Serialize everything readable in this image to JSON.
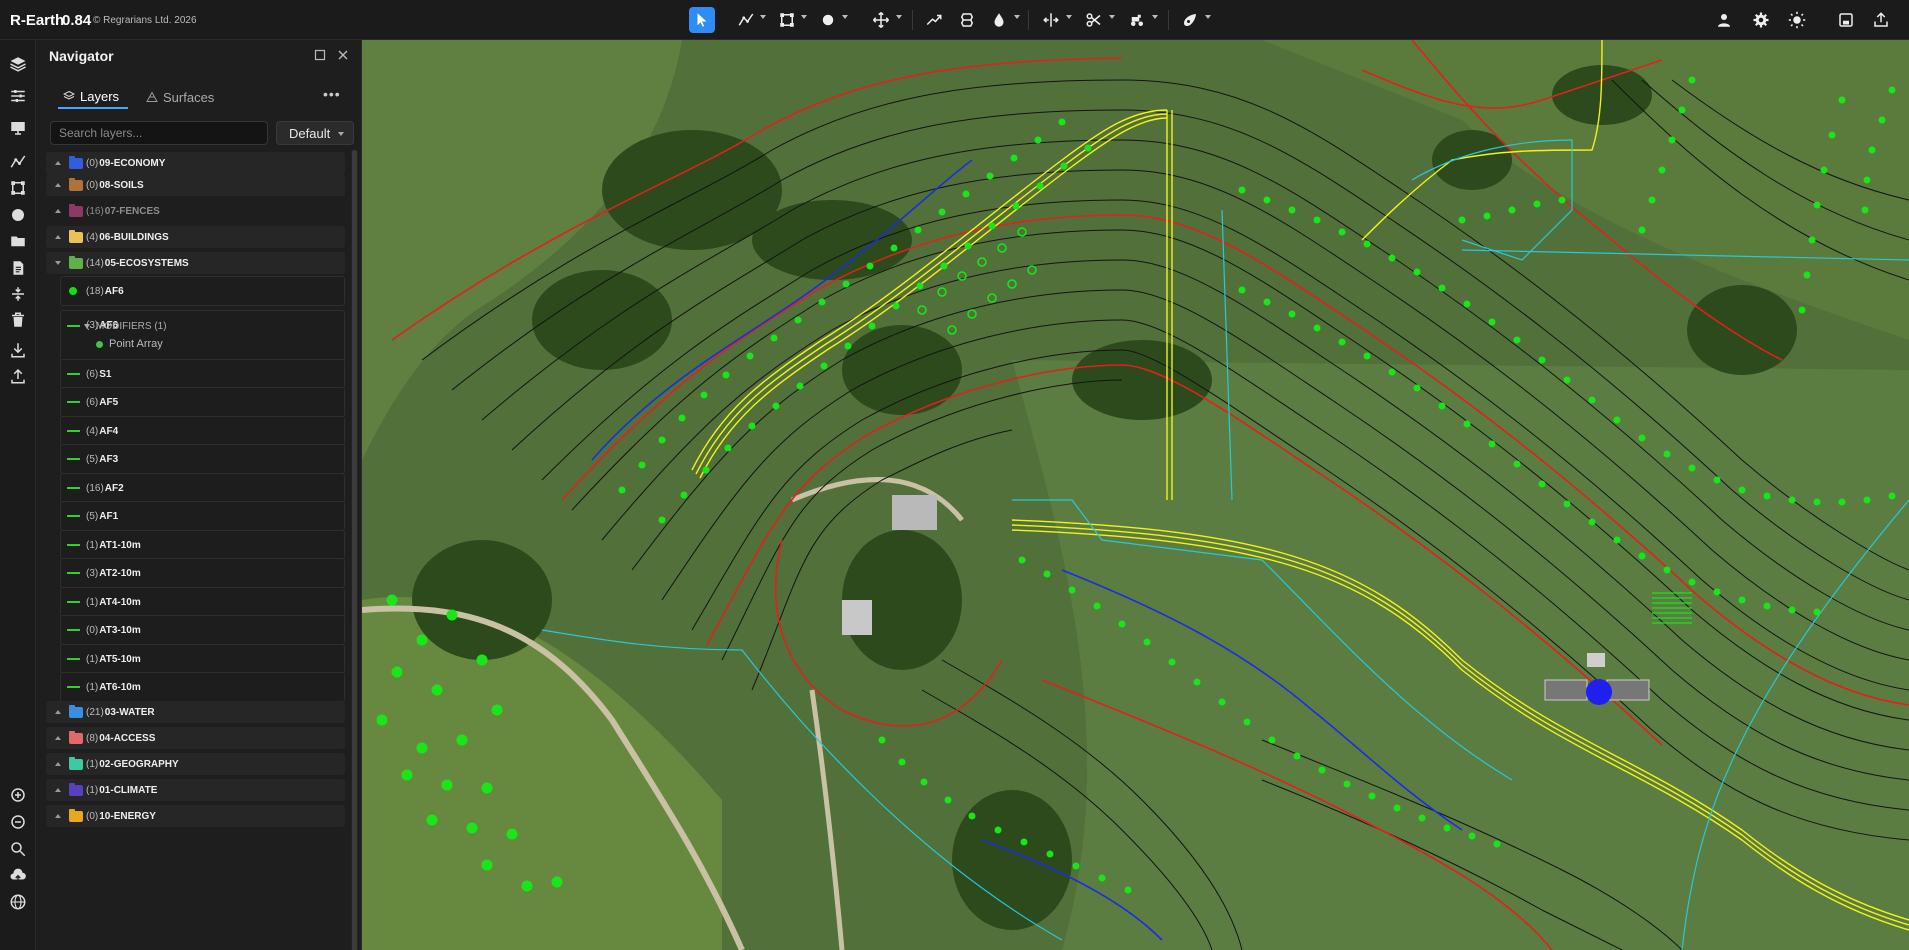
{
  "app": {
    "title": "R-Earth",
    "version": "0.84",
    "copyright": "© Regrarians Ltd. 2026"
  },
  "toolbar": {
    "tools": [
      {
        "name": "select-tool",
        "icon": "cursor-arrow-icon",
        "active": true
      },
      {
        "name": "line-tool",
        "icon": "polyline-icon"
      },
      {
        "name": "shape-tool",
        "icon": "polygon-nodes-icon"
      },
      {
        "name": "point-tool",
        "icon": "circle-point-icon"
      },
      {
        "name": "move-tool",
        "icon": "move-arrows-icon"
      },
      {
        "name": "trend-tool",
        "icon": "trend-line-icon"
      },
      {
        "name": "layers-stack-tool",
        "icon": "stack-icon"
      },
      {
        "name": "water-tool",
        "icon": "water-drop-icon"
      },
      {
        "name": "split-tool",
        "icon": "split-arrows-icon"
      },
      {
        "name": "cut-tool",
        "icon": "scissors-icon"
      },
      {
        "name": "vehicle-tool",
        "icon": "tractor-icon"
      },
      {
        "name": "brush-tool",
        "icon": "brush-icon"
      }
    ],
    "right_icons": [
      "user-icon",
      "gear-icon",
      "sun-icon",
      "save-icon",
      "export-icon"
    ]
  },
  "rail": {
    "top_icons": [
      "layers-icon",
      "sliders-icon",
      "monitor-icon",
      "polyline-icon",
      "nodes-icon",
      "circle-icon",
      "folder-icon",
      "document-icon",
      "adjust-icon",
      "trash-icon",
      "download-icon",
      "upload-icon"
    ],
    "bottom_icons": [
      "zoom-in-icon",
      "zoom-out-icon",
      "search-icon",
      "cloud-upload-icon",
      "globe-icon"
    ]
  },
  "navigator": {
    "title": "Navigator",
    "tabs": [
      {
        "label": "Layers",
        "active": true
      },
      {
        "label": "Surfaces",
        "active": false
      }
    ],
    "search": {
      "placeholder": "Search layers...",
      "value": ""
    },
    "preset": {
      "value": "Default"
    },
    "groups_top": [
      {
        "count": "(0)",
        "name": "09-ECONOMY",
        "color": "#2f5fe0"
      },
      {
        "count": "(0)",
        "name": "08-SOILS",
        "color": "#b2703a"
      },
      {
        "count": "(16)",
        "name": "07-FENCES",
        "color": "#b0487e",
        "dim": true
      },
      {
        "count": "(4)",
        "name": "06-BUILDINGS",
        "color": "#e9c25a"
      },
      {
        "count": "(14)",
        "name": "05-ECOSYSTEMS",
        "color": "#5fb04a",
        "expanded": true
      }
    ],
    "ecosystem_children": [
      {
        "count": "(18)",
        "name": "AF6",
        "symbol": "dot"
      },
      {
        "count": "(3)",
        "name": "AF6",
        "symbol": "line"
      },
      {
        "count": "(6)",
        "name": "S1",
        "symbol": "line"
      },
      {
        "count": "(6)",
        "name": "AF5",
        "symbol": "line"
      },
      {
        "count": "(4)",
        "name": "AF4",
        "symbol": "line"
      },
      {
        "count": "(5)",
        "name": "AF3",
        "symbol": "line"
      },
      {
        "count": "(16)",
        "name": "AF2",
        "symbol": "line"
      },
      {
        "count": "(5)",
        "name": "AF1",
        "symbol": "line"
      },
      {
        "count": "(1)",
        "name": "AT1-10m",
        "symbol": "line"
      },
      {
        "count": "(3)",
        "name": "AT2-10m",
        "symbol": "line"
      },
      {
        "count": "(1)",
        "name": "AT4-10m",
        "symbol": "line"
      },
      {
        "count": "(0)",
        "name": "AT3-10m",
        "symbol": "line"
      },
      {
        "count": "(1)",
        "name": "AT5-10m",
        "symbol": "line"
      },
      {
        "count": "(1)",
        "name": "AT6-10m",
        "symbol": "line"
      }
    ],
    "modifiers_label": "MODIFIERS (1)",
    "modifier_item": "Point Array",
    "groups_bottom": [
      {
        "count": "(21)",
        "name": "03-WATER",
        "color": "#3a8ee0"
      },
      {
        "count": "(8)",
        "name": "04-ACCESS",
        "color": "#e06a6a"
      },
      {
        "count": "(1)",
        "name": "02-GEOGRAPHY",
        "color": "#3ec9a2"
      },
      {
        "count": "(1)",
        "name": "01-CLIMATE",
        "color": "#5a3fc0"
      },
      {
        "count": "(0)",
        "name": "10-ENERGY",
        "color": "#e6a91e"
      }
    ]
  },
  "colors": {
    "accent": "#2f8cf5",
    "contour": "#111111",
    "contour_index": "#e3201b",
    "keyline": "#f2f21a",
    "tree_point": "#19e619",
    "swale": "#1a2ee0",
    "boundary": "#28c8d8"
  }
}
